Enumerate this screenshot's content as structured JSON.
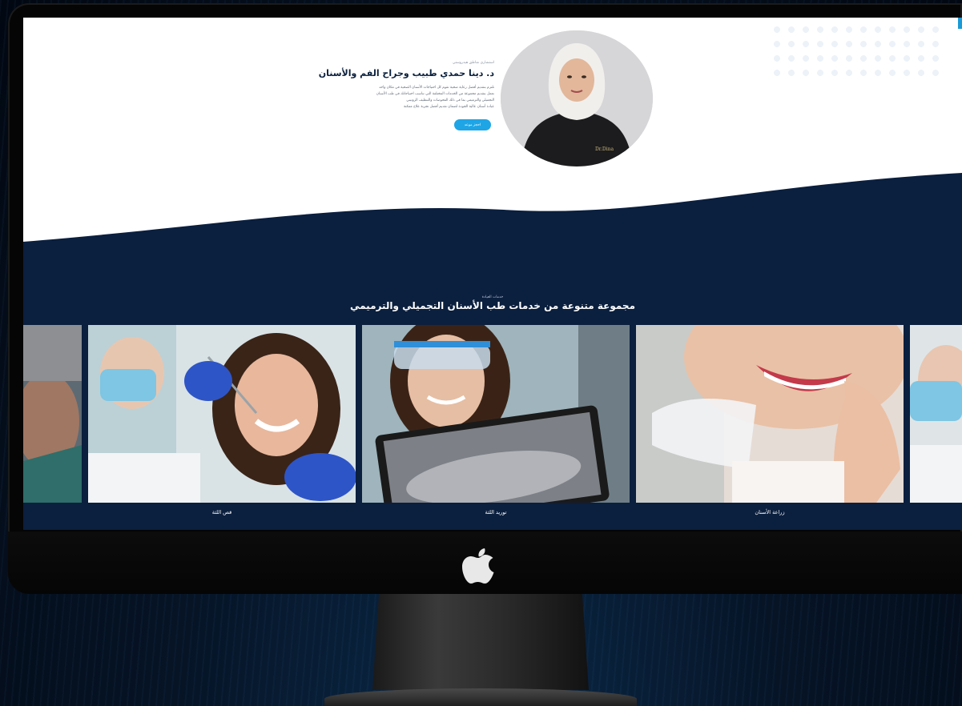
{
  "hero": {
    "eyebrow": "استشاري مناطق هيدروستي",
    "doctor_name": "د. دينا حمدي طبيب وجراح الفم والأسنان",
    "bio_lines": [
      "تلتزم بتقديم أفضل رعاية صحية تقوم كل احتياجات الأسنان الصحية في مكان واحد",
      "نعمل بتقديم مجموعة من الخدمات المختلفة التي تناسب احتياجاتك في طب الأسنان",
      "التجميلي والترميمي بما في ذلك الفحوصات والتنظيف الروتيني",
      "عيادة أسنان عالية الجودة لضمان تقديم أفضل تجربة علاج ممكنة"
    ],
    "cta_label": "احجز موعد"
  },
  "services": {
    "eyebrow": "خدمات العيادة",
    "title": "مجموعة متنوعة من خدمات طب الأسنان التجميلي والترميمي",
    "cards": [
      {
        "caption": "قص اللثة"
      },
      {
        "caption": "توريد اللثة"
      },
      {
        "caption": "زراعة الأسنان"
      }
    ]
  },
  "colors": {
    "navy": "#0b1f3e",
    "accent": "#1ea5e6",
    "background": "#061426"
  },
  "icons": [
    "apple-logo-icon"
  ]
}
